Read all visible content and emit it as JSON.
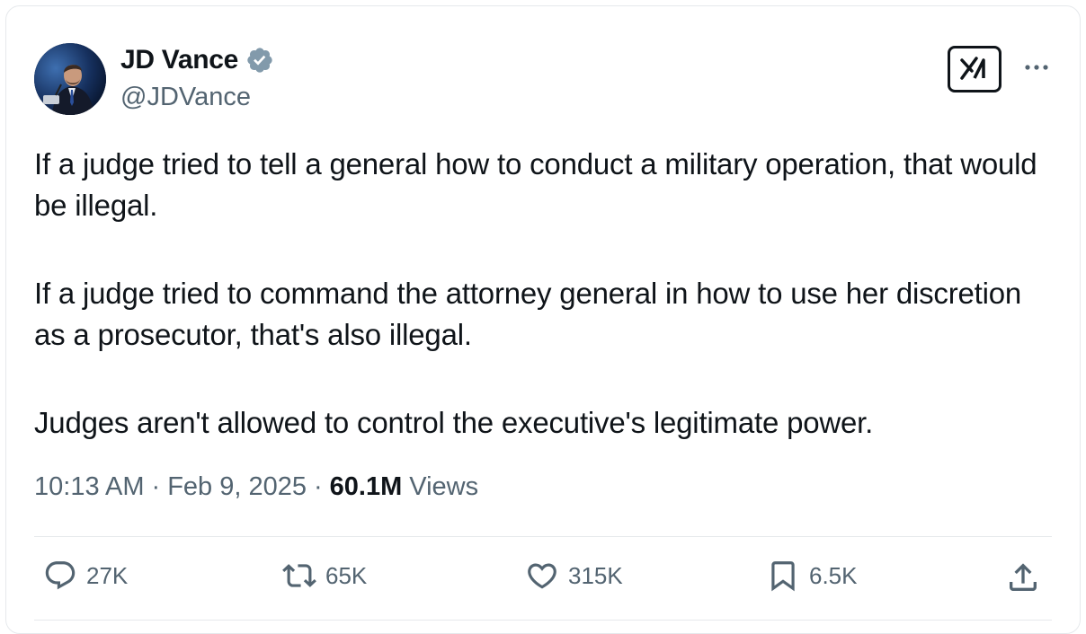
{
  "tweet": {
    "author_name": "JD Vance",
    "handle": "@JDVance",
    "paragraphs": [
      "If a judge tried to tell a general how to conduct a military operation, that would be illegal.",
      "If a judge tried to command the attorney general in how to use her discretion as a prosecutor, that's also illegal.",
      "Judges aren't allowed to control the executive's legitimate power."
    ],
    "time": "10:13 AM",
    "date": "Feb 9, 2025",
    "separator": "·",
    "views_count": "60.1M",
    "views_label": "Views"
  },
  "actions": {
    "replies": "27K",
    "reposts": "65K",
    "likes": "315K",
    "bookmarks": "6.5K"
  },
  "icons": {
    "verified": "verified-badge-icon",
    "grok": "grok-icon",
    "more": "more-icon",
    "reply": "reply-icon",
    "repost": "repost-icon",
    "like": "heart-icon",
    "bookmark": "bookmark-icon",
    "share": "share-icon"
  },
  "colors": {
    "text": "#0f1419",
    "secondary": "#536471",
    "verified": "#829aab",
    "divider": "#e6e9ec"
  }
}
